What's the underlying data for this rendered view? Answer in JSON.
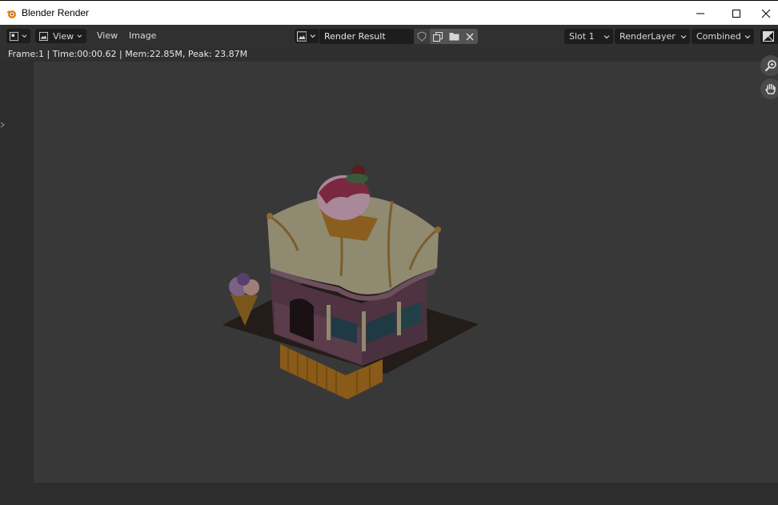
{
  "window": {
    "title": "Blender Render"
  },
  "header": {
    "editor_type_icon": "image-editor-icon",
    "view_mode_label": "View",
    "menus": [
      "View",
      "Image"
    ],
    "image_name": "Render Result",
    "slot": "Slot 1",
    "render_layer": "RenderLayer",
    "pass": "Combined"
  },
  "status": {
    "text": "Frame:1 | Time:00:00.62 | Mem:22.85M, Peak: 23.87M"
  },
  "colors": {
    "header_bg": "#303030",
    "field_bg": "#1d1d1d",
    "viewport_bg": "#2d2d2d",
    "render_bg": "#383838",
    "blender_orange": "#e87d0d"
  },
  "icons": {
    "app": "blender-logo-icon",
    "zoom": "zoom-icon",
    "pan": "hand-icon",
    "fake_user": "shield-icon",
    "duplicate": "duplicate-icon",
    "open": "folder-icon",
    "unlink": "close-icon"
  }
}
